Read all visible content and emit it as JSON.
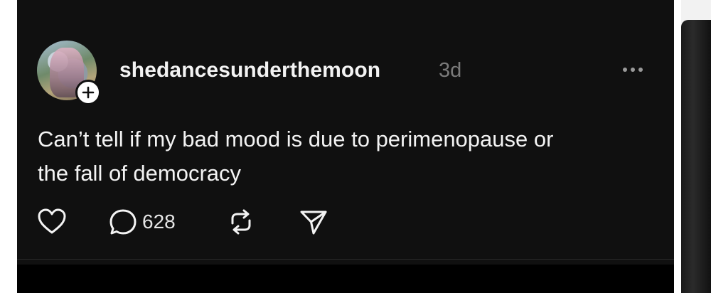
{
  "post": {
    "username": "shedancesunderthemoon",
    "time_ago": "3d",
    "text_line1": "Can’t tell if my bad mood is due to perimenopause or",
    "text_line2": "the fall of democracy",
    "reply_count": "628"
  },
  "icons": {
    "like": "heart-icon",
    "reply": "comment-icon",
    "repost": "repost-icon",
    "share": "send-icon",
    "more": "more-icon",
    "follow": "plus-icon"
  },
  "colors": {
    "background": "#101010",
    "text": "#f3f3f3",
    "muted": "#7a7a7a"
  }
}
